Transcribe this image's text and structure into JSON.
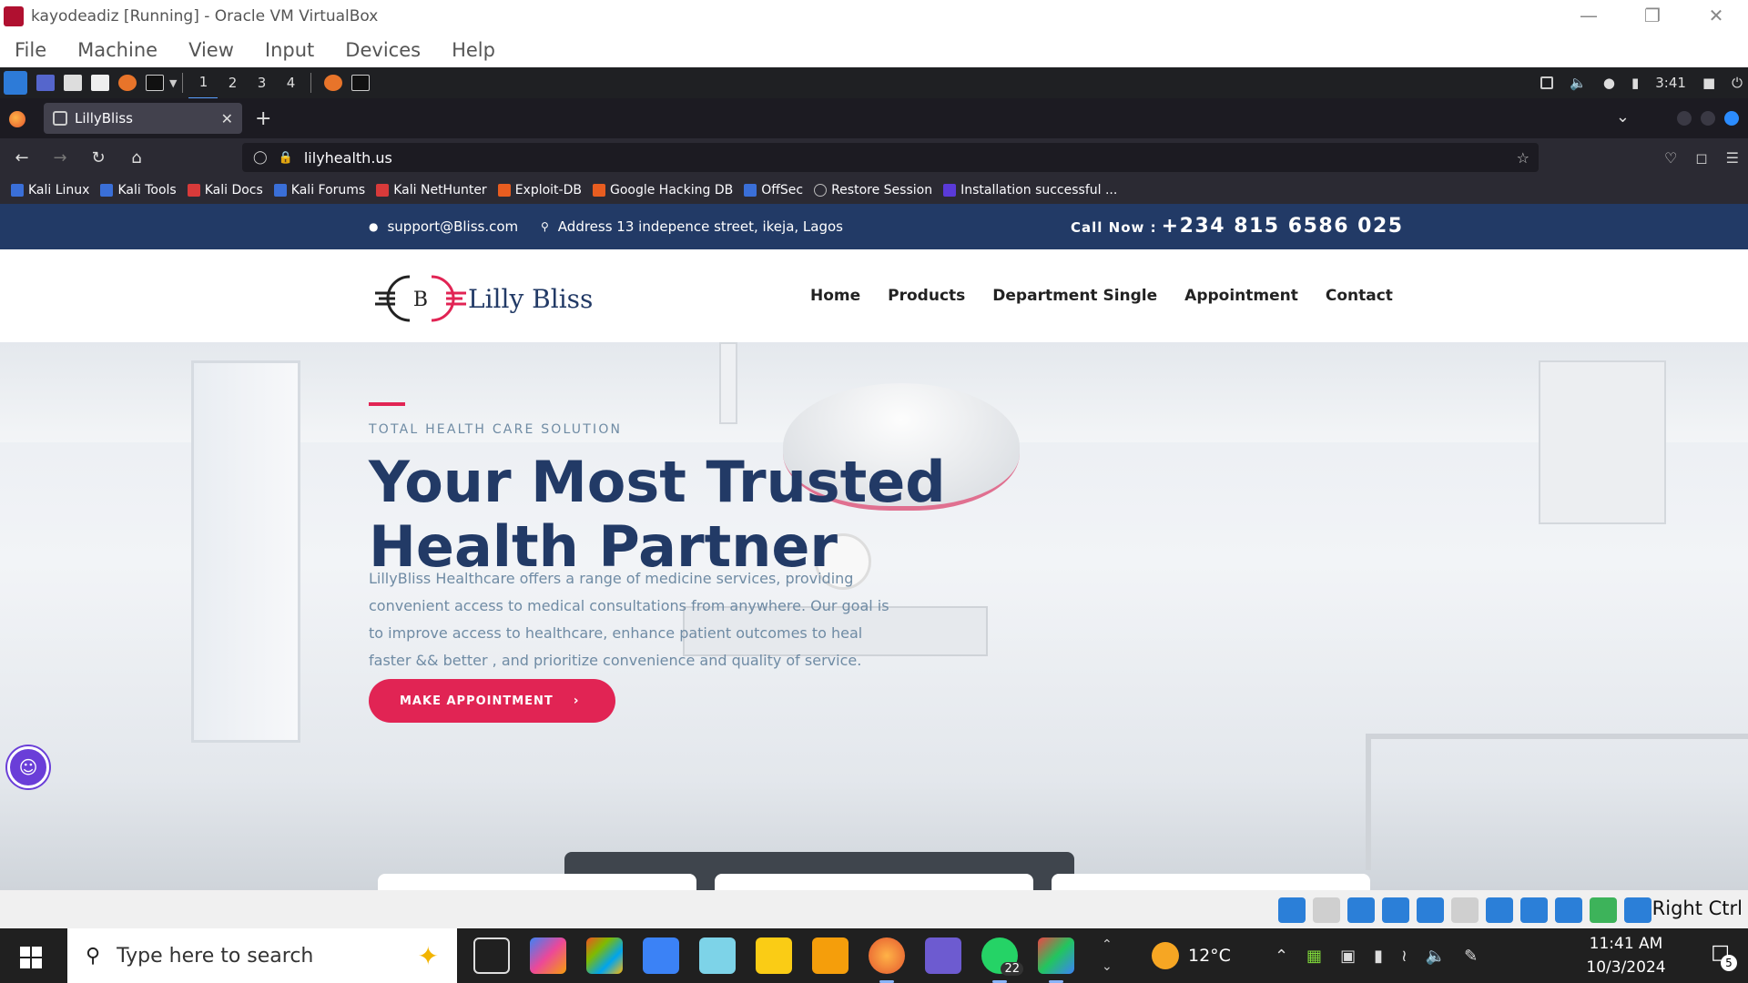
{
  "vbox": {
    "title": "kayodeadiz [Running] - Oracle VM VirtualBox",
    "menu": [
      "File",
      "Machine",
      "View",
      "Input",
      "Devices",
      "Help"
    ],
    "status_right": "Right Ctrl"
  },
  "kali_panel": {
    "workspaces": [
      "1",
      "2",
      "3",
      "4"
    ],
    "time": "3:41"
  },
  "firefox": {
    "tab_title": "LillyBliss",
    "url": "lilyhealth.us",
    "bookmarks": [
      "Kali Linux",
      "Kali Tools",
      "Kali Docs",
      "Kali Forums",
      "Kali NetHunter",
      "Exploit-DB",
      "Google Hacking DB",
      "OffSec",
      "Restore Session",
      "Installation successful ..."
    ],
    "bookmark_colors": [
      "#3a6fd8",
      "#3a6fd8",
      "#d83a3a",
      "#3a6fd8",
      "#d83a3a",
      "#e85d20",
      "#e85d20",
      "#3a6fd8",
      "#bbbbbb",
      "#5a3ad8"
    ]
  },
  "site": {
    "topbar": {
      "email": "support@Bliss.com",
      "address": "Address 13 indepence street, ikeja, Lagos",
      "call_label": "Call Now :",
      "call_number": "+234 815 6586 025"
    },
    "logo": {
      "mark_letter": "B",
      "name": "Lilly Bliss"
    },
    "nav": [
      "Home",
      "Products",
      "Department Single",
      "Appointment",
      "Contact"
    ],
    "hero": {
      "kicker": "TOTAL HEALTH CARE SOLUTION",
      "title_line1": "Your Most Trusted",
      "title_line2": "Health Partner",
      "description": "LillyBliss Healthcare offers a range of medicine services, providing convenient access to medical consultations from anywhere. Our goal is to improve access to healthcare, enhance patient outcomes to heal faster && better , and prioritize convenience and quality of service.",
      "button": "MAKE APPOINTMENT"
    },
    "colors": {
      "navy": "#223a66",
      "accent": "#e12454",
      "muted": "#6f8ba4"
    }
  },
  "windows": {
    "search_placeholder": "Type here to search",
    "weather": "12°C",
    "time": "11:41 AM",
    "date": "10/3/2024",
    "whatsapp_badge": "22",
    "notifications": "5"
  }
}
